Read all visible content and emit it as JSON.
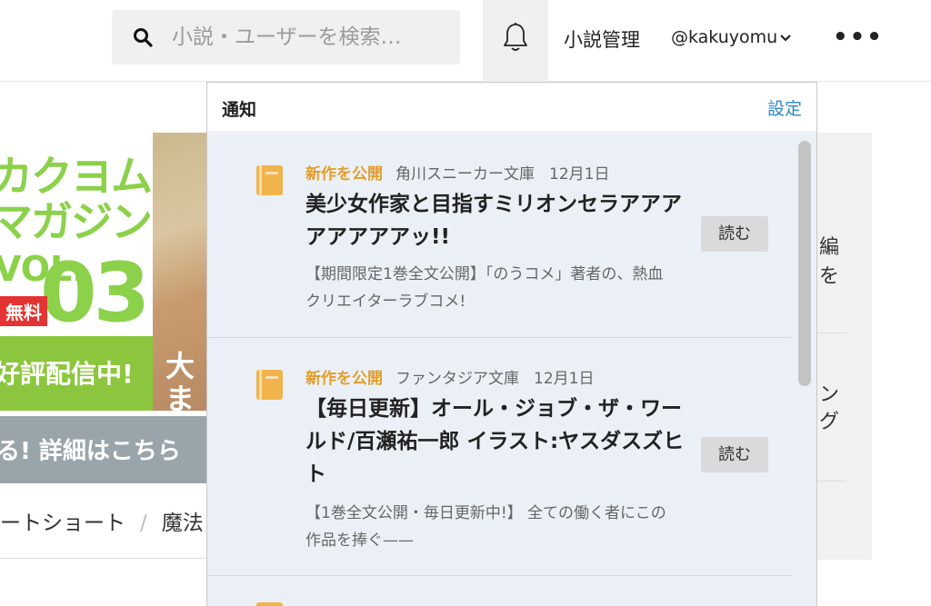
{
  "header": {
    "search_placeholder": "小説・ユーザーを検索…",
    "manage_label": "小説管理",
    "user_label": "@kakuyomu",
    "more_label": "•••"
  },
  "background": {
    "banner_line1": "カクヨム",
    "banner_line2": "マガジン",
    "banner_vol": "VOL.",
    "banner_num": "03",
    "banner_tag": "無料",
    "banner_green": "好評配信中!",
    "banner_art1": "大",
    "banner_art2": "ま",
    "cta": "る! 詳細はこちら",
    "genre1": "ートショート",
    "genre_sep": "/",
    "genre2": "魔法",
    "right1": "編",
    "right2": "を",
    "right3": "ン",
    "right4": "グ"
  },
  "notifications": {
    "title": "通知",
    "settings_label": "設定",
    "items": [
      {
        "kind": "新作を公開",
        "publisher": "角川スニーカー文庫",
        "date": "12月1日",
        "title": "美少女作家と目指すミリオンセラアアアアアアアアッ!!",
        "desc": "【期間限定1巻全文公開】「のうコメ」著者の、熱血クリエイターラブコメ!",
        "button": "読む"
      },
      {
        "kind": "新作を公開",
        "publisher": "ファンタジア文庫",
        "date": "12月1日",
        "title": "【毎日更新】オール・ジョブ・ザ・ワールド/百瀬祐一郎 イラスト:ヤスダスズヒト",
        "desc": "【1巻全文公開・毎日更新中!】 全ての働く者にこの作品を捧ぐ——",
        "button": "読む"
      }
    ]
  },
  "colors": {
    "accent_link": "#2f86c9",
    "kind_orange": "#e39d2a",
    "book_icon": "#f1b44c",
    "list_bg": "#eaf0f6"
  }
}
